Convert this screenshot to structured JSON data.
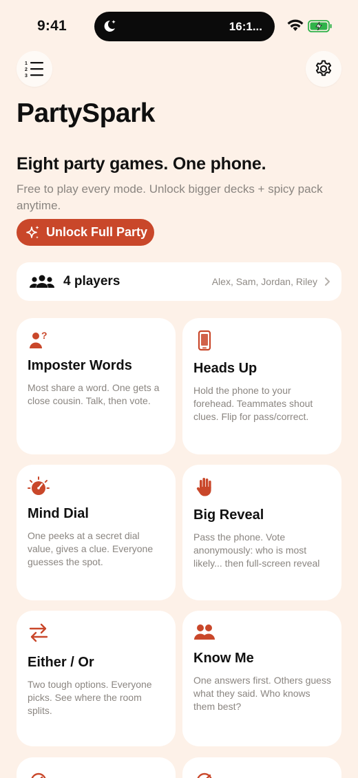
{
  "status_bar": {
    "time": "9:41",
    "island_text": "16:1..."
  },
  "app": {
    "title": "PartySpark",
    "headline": "Eight party games. One phone.",
    "subtitle": "Free to play every mode. Unlock bigger decks + spicy pack anytime.",
    "unlock_label": "Unlock Full Party"
  },
  "players": {
    "count_label": "4 players",
    "names": "Alex, Sam, Jordan, Riley"
  },
  "games": [
    {
      "title": "Imposter Words",
      "description": "Most share a word. One gets a close cousin. Talk, then vote.",
      "icon": "person-question-icon"
    },
    {
      "title": "Heads Up",
      "description": "Hold the phone to your forehead. Teammates shout clues. Flip for pass/correct.",
      "icon": "phone-icon"
    },
    {
      "title": "Mind Dial",
      "description": "One peeks at a secret dial value, gives a clue. Everyone guesses the spot.",
      "icon": "dial-icon"
    },
    {
      "title": "Big Reveal",
      "description_lines": [
        "Pass the phone. Vote",
        "anonymously: who is most",
        "likely... then full-screen reveal"
      ],
      "icon": "raised-hand-icon"
    },
    {
      "title": "Either / Or",
      "description": "Two tough options. Everyone picks. See where the room splits.",
      "icon": "swap-arrows-icon"
    },
    {
      "title": "Know Me",
      "description": "One answers first. Others guess what they said. Who knows them best?",
      "icon": "two-people-icon"
    }
  ],
  "colors": {
    "accent": "#c9472a",
    "background": "#fdf1e8",
    "card": "#ffffff",
    "muted_text": "#8a8580"
  }
}
